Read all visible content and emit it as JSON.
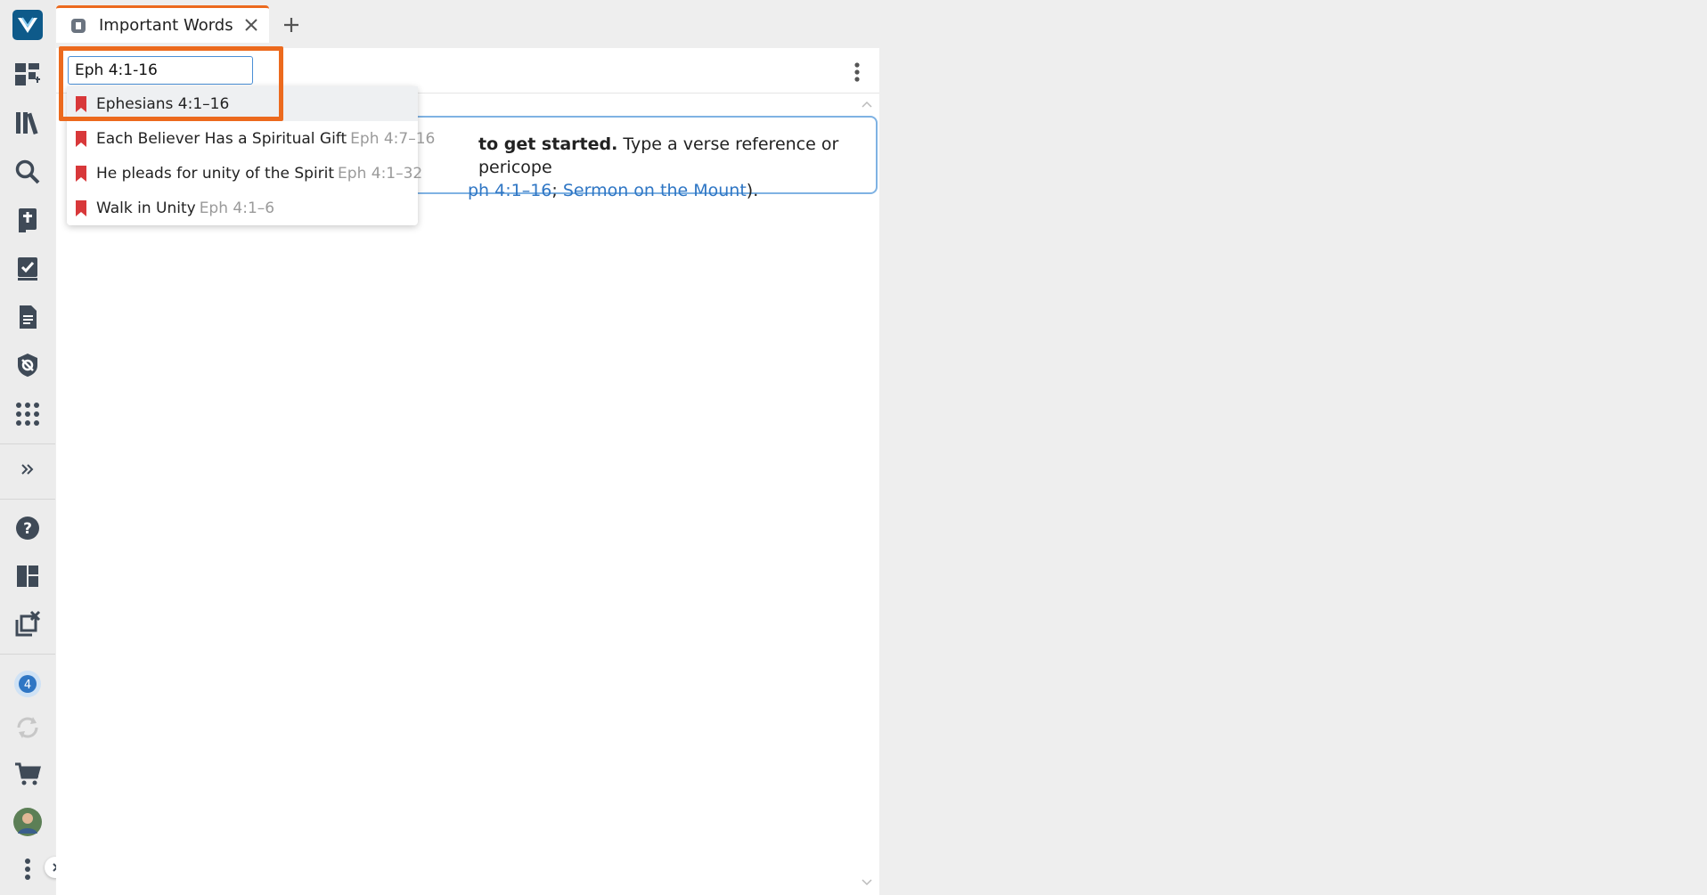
{
  "tab": {
    "title": "Important Words"
  },
  "search": {
    "value": "Eph 4:1-16"
  },
  "dropdown": {
    "items": [
      {
        "label": "Ephesians 4:1–16",
        "ref": ""
      },
      {
        "label": "Each Believer Has a Spiritual Gift",
        "ref": "Eph 4:7–16"
      },
      {
        "label": "He pleads for unity of the Spirit",
        "ref": "Eph 4:1–32"
      },
      {
        "label": "Walk in Unity",
        "ref": "Eph 4:1–6"
      }
    ]
  },
  "info": {
    "bold_text": "to get started.",
    "text1": " Type a verse reference or pericope",
    "link1": "ph 4:1–16",
    "separator": "; ",
    "link2": "Sermon on the Mount",
    "end": ")."
  },
  "rail": {
    "icons": [
      "logo-icon",
      "dashboard-add-icon",
      "library-icon",
      "search-icon",
      "bible-icon",
      "checklist-icon",
      "document-icon",
      "shield-icon",
      "apps-grid-icon",
      "expand-icon",
      "help-icon",
      "layouts-icon",
      "close-panels-icon",
      "notifications-icon",
      "sync-icon",
      "cart-icon",
      "avatar",
      "more-icon"
    ],
    "notification_count": "4"
  },
  "colors": {
    "accent": "#ec6a1e",
    "link": "#2f76c4",
    "bookmark": "#d8383a",
    "brand": "#0e5a8a"
  }
}
